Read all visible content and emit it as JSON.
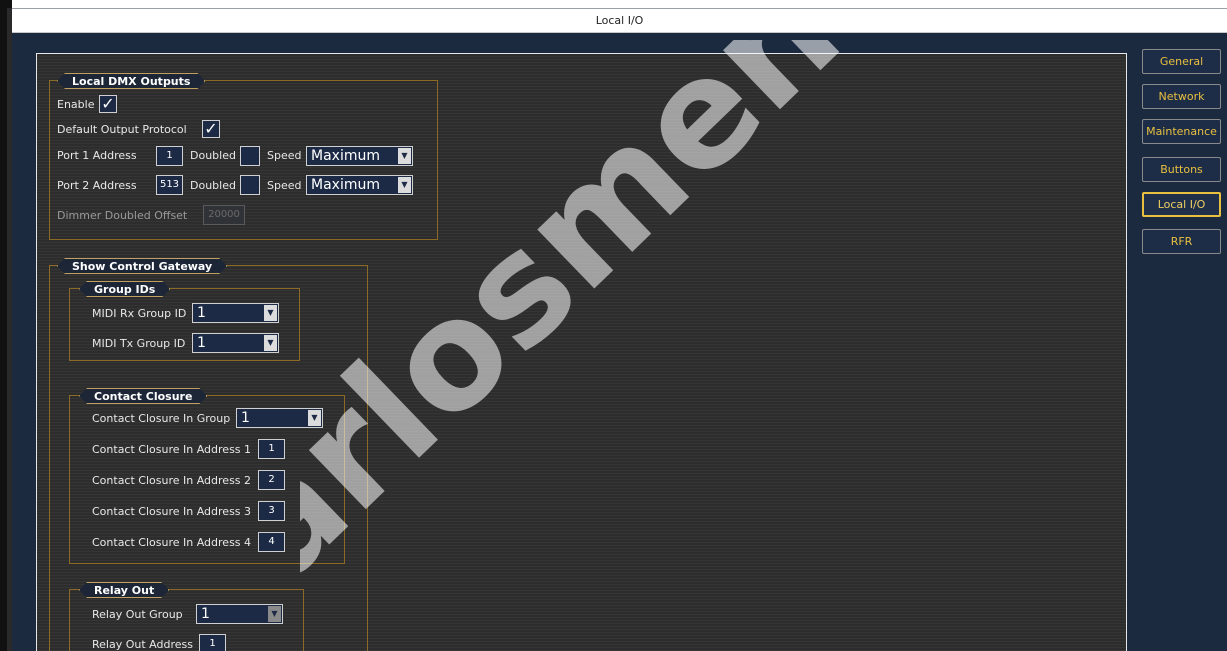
{
  "window": {
    "title": "Local I/O"
  },
  "sidebar": {
    "items": [
      {
        "label": "General"
      },
      {
        "label": "Network"
      },
      {
        "label": "Maintenance"
      },
      {
        "label": "Buttons"
      },
      {
        "label": "Local I/O",
        "active": true
      },
      {
        "label": "RFR"
      }
    ]
  },
  "dmx": {
    "legend": "Local DMX Outputs",
    "enable_label": "Enable",
    "enable_checked": "✓",
    "default_protocol_label": "Default Output Protocol",
    "default_protocol_checked": "✓",
    "port1": {
      "label": "Port 1 Address",
      "value": "1",
      "doubled_label": "Doubled",
      "speed_label": "Speed",
      "speed_value": "Maximum"
    },
    "port2": {
      "label": "Port 2 Address",
      "value": "513",
      "doubled_label": "Doubled",
      "speed_label": "Speed",
      "speed_value": "Maximum"
    },
    "dimmer_offset_label": "Dimmer Doubled Offset",
    "dimmer_offset_value": "20000"
  },
  "gateway": {
    "legend": "Show Control Gateway",
    "group_ids": {
      "legend": "Group IDs",
      "midi_rx_label": "MIDI Rx Group ID",
      "midi_rx_value": "1",
      "midi_tx_label": "MIDI Tx Group ID",
      "midi_tx_value": "1"
    },
    "contact_closure": {
      "legend": "Contact Closure",
      "group_label": "Contact Closure In Group",
      "group_value": "1",
      "addresses": [
        {
          "label": "Contact Closure In Address 1",
          "value": "1"
        },
        {
          "label": "Contact Closure In Address 2",
          "value": "2"
        },
        {
          "label": "Contact Closure In Address 3",
          "value": "3"
        },
        {
          "label": "Contact Closure In Address 4",
          "value": "4"
        }
      ]
    },
    "relay_out": {
      "legend": "Relay Out",
      "group_label": "Relay Out Group",
      "group_value": "1",
      "address_label": "Relay Out Address",
      "address_value": "1"
    }
  },
  "watermark": {
    "text": "carlosmendoza"
  },
  "colors": {
    "accent": "#e8c040",
    "panel": "#2d2d2d",
    "window_bg": "#1c2a40",
    "field_bg": "#1c2a45"
  }
}
